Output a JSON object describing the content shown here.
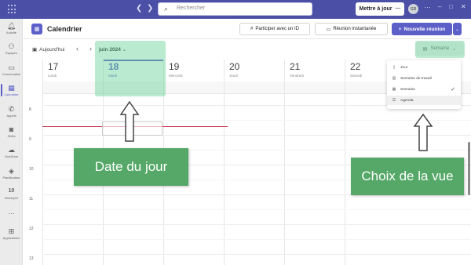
{
  "topbar": {
    "back_icon": "chevron-left-icon",
    "forward_icon": "chevron-right-icon",
    "search_placeholder": "Rechercher",
    "update_label": "Mettre à jour",
    "update_more": "···",
    "avatar_initials": "GR",
    "more": "···",
    "minimize": "–",
    "maximize": "□",
    "close": "✕",
    "bar_color": "#4b4fa6"
  },
  "rail": {
    "items": [
      {
        "label": "Activité",
        "icon": "bell-icon"
      },
      {
        "label": "Équipes",
        "icon": "teams-icon"
      },
      {
        "label": "Conversation",
        "icon": "chat-icon"
      },
      {
        "label": "Calendrier",
        "icon": "calendar-icon",
        "active": true
      },
      {
        "label": "Appels",
        "icon": "phone-icon"
      },
      {
        "label": "Shifts",
        "icon": "shifts-icon"
      },
      {
        "label": "OneDrive",
        "icon": "cloud-icon"
      },
      {
        "label": "Planificateur",
        "icon": "planner-icon"
      },
      {
        "label": "Weekly10",
        "icon": "weekly10-icon"
      },
      {
        "label": "···",
        "icon": "more-icon"
      },
      {
        "label": "Applications",
        "icon": "apps-icon"
      }
    ]
  },
  "header": {
    "title": "Calendrier",
    "join_id_label": "Participer avec un ID",
    "instant_meeting_label": "Réunion instantanée",
    "new_meeting_label": "Nouvelle réunion",
    "accent_color": "#5b5fc7"
  },
  "toolbar": {
    "today_label": "Aujourd'hui",
    "month_label": "juin 2024",
    "view_label": "Semaine"
  },
  "days": [
    {
      "num": "17",
      "name": "Lundi"
    },
    {
      "num": "18",
      "name": "Mardi",
      "today": true
    },
    {
      "num": "19",
      "name": "Mercredi"
    },
    {
      "num": "20",
      "name": "Jeudi"
    },
    {
      "num": "21",
      "name": "Vendredi"
    },
    {
      "num": "22",
      "name": "Samedi"
    }
  ],
  "hours": [
    "8",
    "9",
    "10",
    "11",
    "12",
    "13"
  ],
  "view_menu": {
    "items": [
      {
        "label": "Jour",
        "icon": "day-icon"
      },
      {
        "label": "Semaine de travail",
        "icon": "workweek-icon"
      },
      {
        "label": "Semaine",
        "icon": "week-icon",
        "checked": true
      },
      {
        "label": "Agenda",
        "icon": "agenda-icon",
        "hover": true
      }
    ],
    "check": "✓"
  },
  "annotations": {
    "date_note": "Date du jour",
    "view_note": "Choix de la vue",
    "highlight_color": "#67d097",
    "note_color": "#55a867"
  }
}
